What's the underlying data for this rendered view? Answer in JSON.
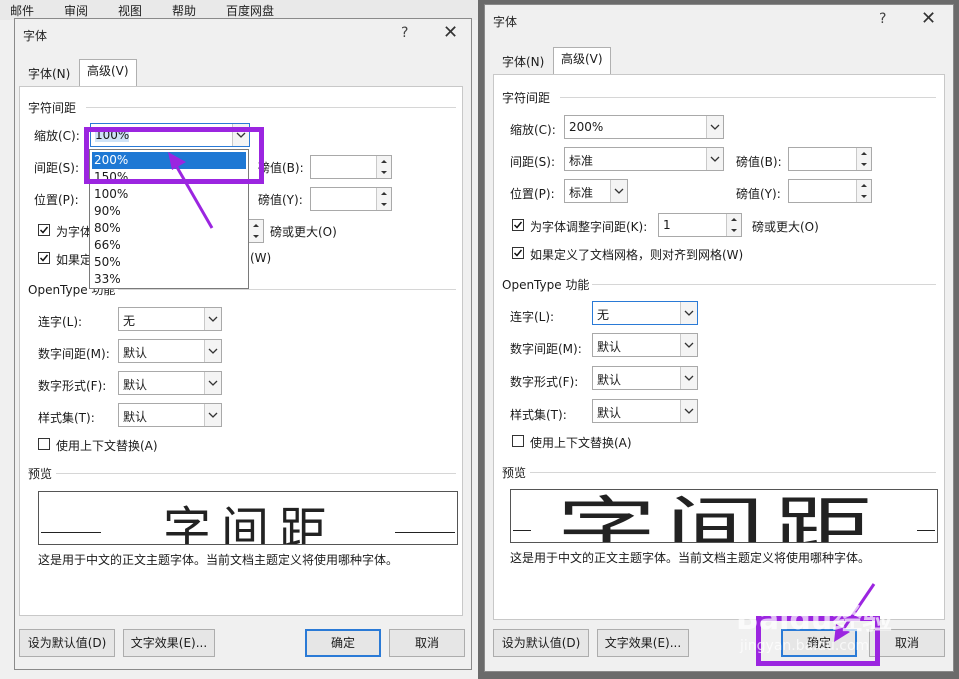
{
  "menubar": [
    "邮件",
    "审阅",
    "视图",
    "帮助",
    "百度网盘"
  ],
  "left_dialog": {
    "title": "字体",
    "help": "?",
    "tabs": [
      "字体(N)",
      "高级(V)"
    ],
    "section_spacing": "字符间距",
    "scale_label": "缩放(C):",
    "scale_value": "100%",
    "spacing_label": "间距(S):",
    "position_label": "位置(P):",
    "by_label_1": "磅值(B):",
    "by_label_2": "磅值(Y):",
    "kern_label": "为字体",
    "kern_suffix": "磅或更大(O)",
    "grid_label": "如果定",
    "grid_suffix": "(W)",
    "opentype_label": "OpenType 功能",
    "ligature_label": "连字(L):",
    "ligature_value": "无",
    "numspacing_label": "数字间距(M):",
    "numspacing_value": "默认",
    "numform_label": "数字形式(F):",
    "numform_value": "默认",
    "styleset_label": "样式集(T):",
    "styleset_value": "默认",
    "contextual_label": "使用上下文替换(A)",
    "preview_label": "预览",
    "preview_text": "字间距",
    "description": "这是用于中文的正文主题字体。当前文档主题定义将使用哪种字体。",
    "btn_default": "设为默认值(D)",
    "btn_effects": "文字效果(E)...",
    "btn_ok": "确定",
    "btn_cancel": "取消",
    "dropdown_options": [
      "200%",
      "150%",
      "100%",
      "90%",
      "80%",
      "66%",
      "50%",
      "33%"
    ],
    "dropdown_selected": "200%"
  },
  "right_dialog": {
    "title": "字体",
    "help": "?",
    "tabs": [
      "字体(N)",
      "高级(V)"
    ],
    "section_spacing": "字符间距",
    "scale_label": "缩放(C):",
    "scale_value": "200%",
    "spacing_label": "间距(S):",
    "spacing_value": "标准",
    "by_label_1": "磅值(B):",
    "position_label": "位置(P):",
    "position_value": "标准",
    "by_label_2": "磅值(Y):",
    "kern_label": "为字体调整字间距(K):",
    "kern_value": "1",
    "kern_suffix": "磅或更大(O)",
    "grid_label": "如果定义了文档网格，则对齐到网格(W)",
    "opentype_label": "OpenType 功能",
    "ligature_label": "连字(L):",
    "ligature_value": "无",
    "numspacing_label": "数字间距(M):",
    "numspacing_value": "默认",
    "numform_label": "数字形式(F):",
    "numform_value": "默认",
    "styleset_label": "样式集(T):",
    "styleset_value": "默认",
    "contextual_label": "使用上下文替换(A)",
    "preview_label": "预览",
    "preview_text": "字间距",
    "description": "这是用于中文的正文主题字体。当前文档主题定义将使用哪种字体。",
    "btn_default": "设为默认值(D)",
    "btn_effects": "文字效果(E)...",
    "btn_ok": "确定",
    "btn_cancel": "取消"
  },
  "colors": {
    "highlight_purple": "#9b25e0",
    "selection_blue": "#1e78d4",
    "focus_blue": "#2a7ad6"
  },
  "watermark": {
    "brand": "Baidu经验",
    "url": "jingyan.baidu.com"
  }
}
